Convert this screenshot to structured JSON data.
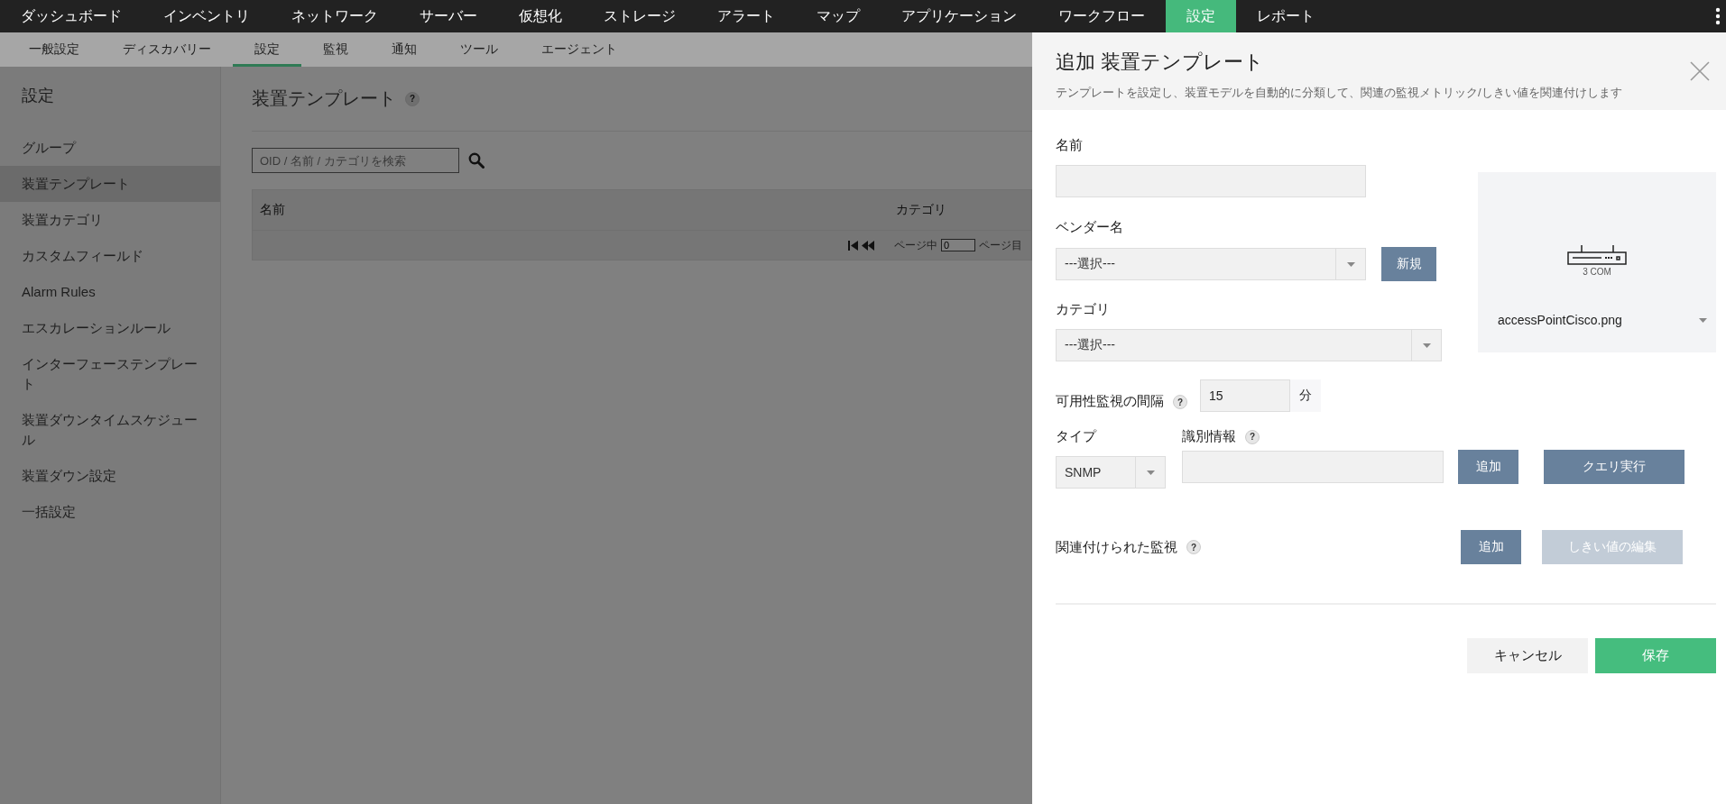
{
  "top_nav": [
    {
      "label": "ダッシュボード",
      "selected": false
    },
    {
      "label": "インベントリ",
      "selected": false
    },
    {
      "label": "ネットワーク",
      "selected": false
    },
    {
      "label": "サーバー",
      "selected": false
    },
    {
      "label": "仮想化",
      "selected": false
    },
    {
      "label": "ストレージ",
      "selected": false
    },
    {
      "label": "アラート",
      "selected": false
    },
    {
      "label": "マップ",
      "selected": false
    },
    {
      "label": "アプリケーション",
      "selected": false
    },
    {
      "label": "ワークフロー",
      "selected": false
    },
    {
      "label": "設定",
      "selected": true
    },
    {
      "label": "レポート",
      "selected": false
    }
  ],
  "sub_nav": [
    {
      "label": "一般設定",
      "selected": false
    },
    {
      "label": "ディスカバリー",
      "selected": false
    },
    {
      "label": "設定",
      "selected": true
    },
    {
      "label": "監視",
      "selected": false
    },
    {
      "label": "通知",
      "selected": false
    },
    {
      "label": "ツール",
      "selected": false
    },
    {
      "label": "エージェント",
      "selected": false
    }
  ],
  "sidebar": {
    "title": "設定",
    "items": [
      {
        "label": "グループ",
        "selected": false
      },
      {
        "label": "装置テンプレート",
        "selected": true
      },
      {
        "label": "装置カテゴリ",
        "selected": false
      },
      {
        "label": "カスタムフィールド",
        "selected": false
      },
      {
        "label": "Alarm Rules",
        "selected": false
      },
      {
        "label": "エスカレーションルール",
        "selected": false
      },
      {
        "label": "インターフェーステンプレート",
        "selected": false
      },
      {
        "label": "装置ダウンタイムスケジュール",
        "selected": false
      },
      {
        "label": "装置ダウン設定",
        "selected": false
      },
      {
        "label": "一括設定",
        "selected": false
      }
    ]
  },
  "main": {
    "title": "装置テンプレート",
    "help": "?",
    "search": {
      "placeholder": "OID / 名前 / カテゴリを検索"
    },
    "table": {
      "columns": [
        "名前",
        "カテゴリ"
      ],
      "pager": {
        "before": "ページ中",
        "value": "0",
        "after": "ページ目"
      }
    }
  },
  "panel": {
    "title": "追加 装置テンプレート",
    "subtitle": "テンプレートを設定し、装置モデルを自動的に分類して、関連の監視メトリック/しきい値を関連付けします",
    "name": {
      "label": "名前"
    },
    "vendor": {
      "label": "ベンダー名",
      "value": "---選択---",
      "button": "新規"
    },
    "category": {
      "label": "カテゴリ",
      "value": "---選択---"
    },
    "image": {
      "caption": "3 COM",
      "filename": "accessPointCisco.png"
    },
    "interval": {
      "label": "可用性監視の間隔",
      "help": "?",
      "value": "15",
      "unit": "分"
    },
    "type": {
      "label": "タイプ",
      "value": "SNMP"
    },
    "identification": {
      "label": "識別情報",
      "help": "?",
      "buttons": [
        {
          "label": "追加",
          "disabled": false
        },
        {
          "label": "クエリ実行",
          "disabled": false
        }
      ]
    },
    "monitors": {
      "label": "関連付けられた監視",
      "help": "?",
      "buttons": [
        {
          "label": "追加",
          "disabled": false
        },
        {
          "label": "しきい値の編集",
          "disabled": true
        }
      ]
    },
    "footer": {
      "cancel": "キャンセル",
      "save": "保存"
    }
  }
}
